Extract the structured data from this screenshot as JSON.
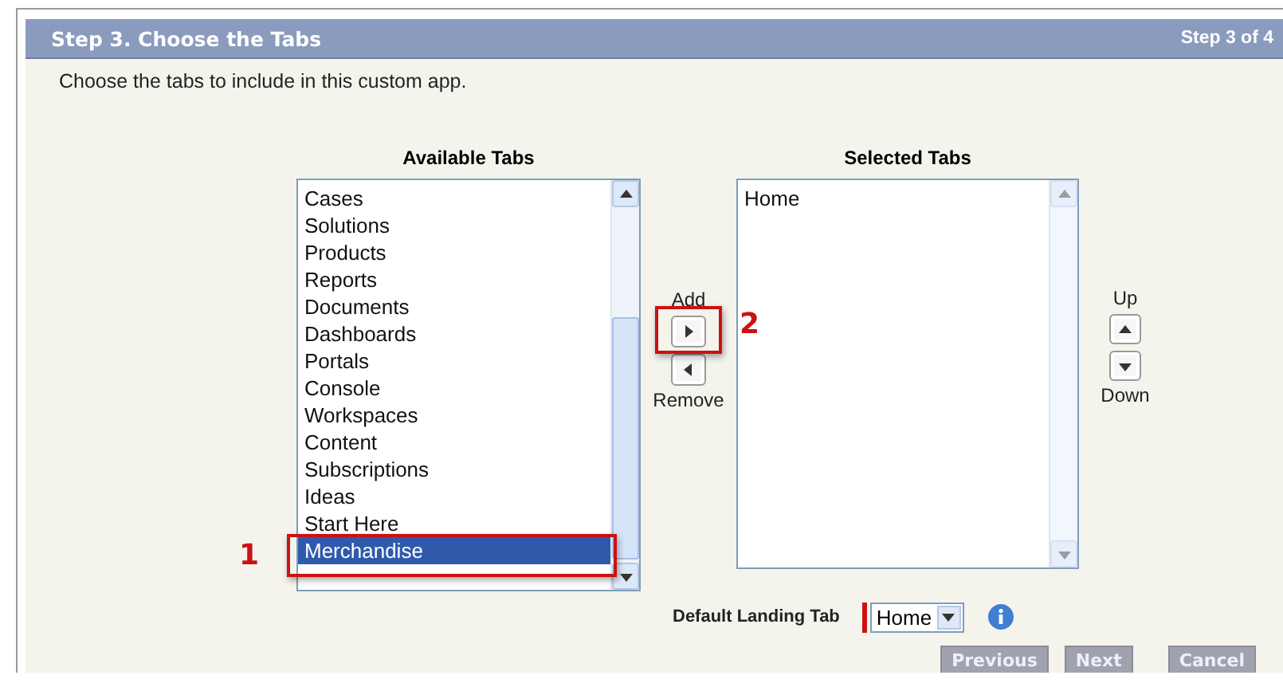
{
  "header": {
    "title": "Step 3. Choose the Tabs",
    "step": "Step 3 of 4"
  },
  "instructions": "Choose the tabs to include in this custom app.",
  "available": {
    "label": "Available Tabs",
    "items": [
      {
        "label": "Cases",
        "selected": false
      },
      {
        "label": "Solutions",
        "selected": false
      },
      {
        "label": "Products",
        "selected": false
      },
      {
        "label": "Reports",
        "selected": false
      },
      {
        "label": "Documents",
        "selected": false
      },
      {
        "label": "Dashboards",
        "selected": false
      },
      {
        "label": "Portals",
        "selected": false
      },
      {
        "label": "Console",
        "selected": false
      },
      {
        "label": "Workspaces",
        "selected": false
      },
      {
        "label": "Content",
        "selected": false
      },
      {
        "label": "Subscriptions",
        "selected": false
      },
      {
        "label": "Ideas",
        "selected": false
      },
      {
        "label": "Start Here",
        "selected": false
      },
      {
        "label": "Merchandise",
        "selected": true
      }
    ]
  },
  "move_controls": [
    {
      "kind": "add",
      "label": "Add"
    },
    {
      "kind": "remove",
      "label": "Remove"
    }
  ],
  "selected": {
    "label": "Selected Tabs",
    "items": [
      {
        "label": "Home",
        "selected": false
      }
    ]
  },
  "order_controls": [
    {
      "kind": "up",
      "label": "Up"
    },
    {
      "kind": "down",
      "label": "Down"
    }
  ],
  "default_landing_tab": {
    "label": "Default Landing Tab",
    "value": "Home",
    "required": true
  },
  "buttons": [
    {
      "label": "Previous"
    },
    {
      "label": "Next"
    },
    {
      "label": "Cancel"
    }
  ],
  "callouts": [
    {
      "number": "1",
      "kind": "list"
    },
    {
      "number": "2",
      "kind": "button"
    }
  ]
}
